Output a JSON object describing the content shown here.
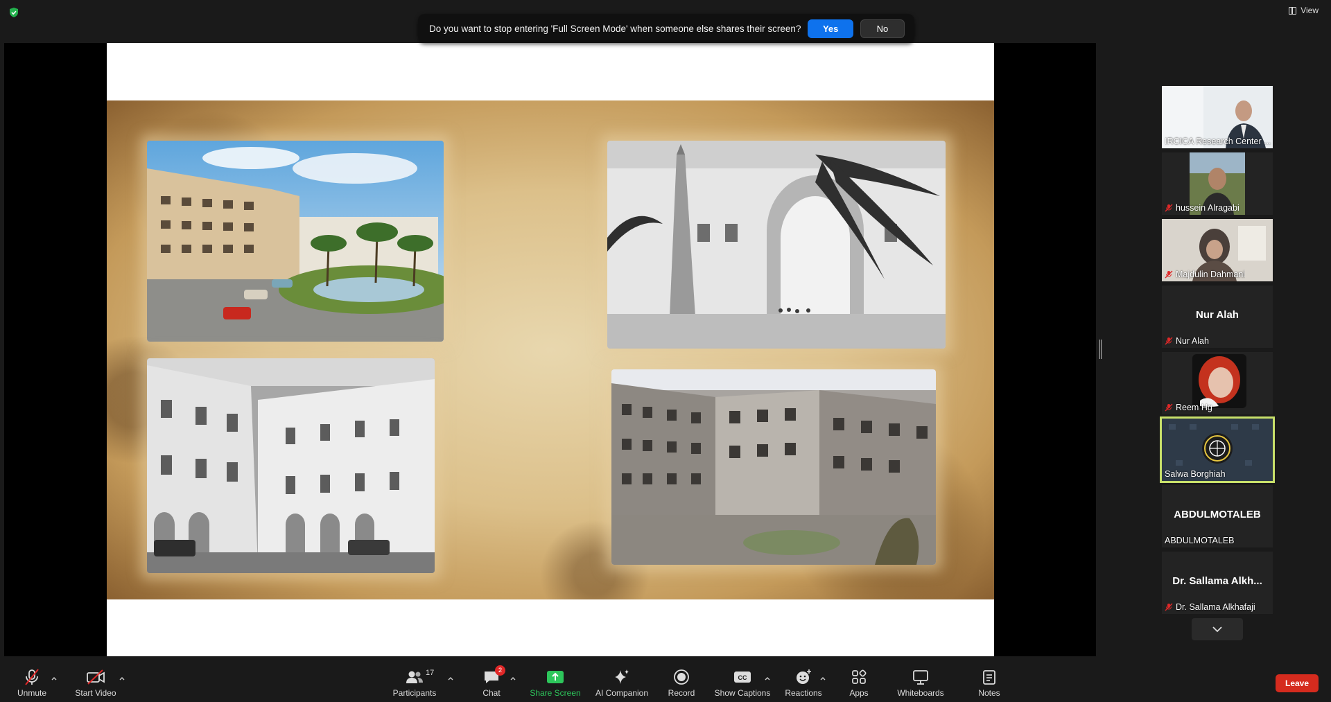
{
  "top": {
    "view_label": "View"
  },
  "notification": {
    "message": "Do you want to stop entering 'Full Screen Mode' when someone else shares their screen?",
    "yes_label": "Yes",
    "no_label": "No"
  },
  "participants": [
    {
      "name": "IRCICA Research Center ...",
      "muted": false,
      "kind": "video"
    },
    {
      "name": "hussein Alragabi",
      "muted": true,
      "kind": "video"
    },
    {
      "name": "Majdulin Dahmani",
      "muted": true,
      "kind": "video"
    },
    {
      "name": "Nur Alah",
      "display": "Nur Alah",
      "muted": true,
      "kind": "name"
    },
    {
      "name": "Reem Hg",
      "muted": true,
      "kind": "avatar"
    },
    {
      "name": "Salwa Borghiah",
      "muted": false,
      "kind": "logo",
      "active": true
    },
    {
      "name": "ABDULMOTALEB",
      "display": "ABDULMOTALEB",
      "muted": false,
      "kind": "name"
    },
    {
      "name": "Dr. Sallama Alkhafaji",
      "display": "Dr. Sallama Alkh...",
      "muted": true,
      "kind": "name"
    }
  ],
  "toolbar": {
    "unmute": "Unmute",
    "start_video": "Start Video",
    "participants": "Participants",
    "participants_count": "17",
    "chat": "Chat",
    "chat_badge": "2",
    "share_screen": "Share Screen",
    "ai_companion": "AI Companion",
    "record": "Record",
    "show_captions": "Show Captions",
    "reactions": "Reactions",
    "apps": "Apps",
    "whiteboards": "Whiteboards",
    "notes": "Notes",
    "leave": "Leave"
  },
  "colors": {
    "accent_blue": "#0e72ed",
    "share_green": "#2dc65b",
    "leave_red": "#d52b1e",
    "active_outline": "#c8e06a"
  }
}
